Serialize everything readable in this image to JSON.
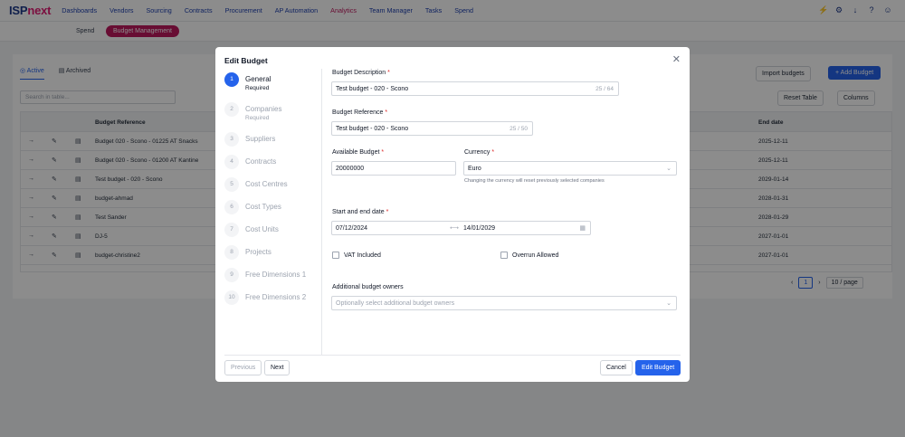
{
  "app": {
    "logo_isp": "ISP",
    "logo_next": "next"
  },
  "nav": [
    "Dashboards",
    "Vendors",
    "Sourcing",
    "Contracts",
    "Procurement",
    "AP Automation",
    "Analytics",
    "Team Manager",
    "Tasks",
    "Spend"
  ],
  "subnav": {
    "spend": "Spend",
    "budget_management": "Budget Management"
  },
  "page": {
    "tab_active": "Active",
    "tab_archived": "Archived",
    "search_placeholder": "Search in table...",
    "import_button": "Import budgets",
    "add_button": "+ Add Budget",
    "reset_button": "Reset Table",
    "columns_button": "Columns",
    "col_reference": "Budget Reference",
    "col_end_date": "End date",
    "rows": [
      {
        "ref": "Budget 020 - Scono - 01225 AT Snacks",
        "end": "2025-12-11"
      },
      {
        "ref": "Budget 020 - Scono - 01200 AT Kantine",
        "end": "2025-12-11"
      },
      {
        "ref": "Test budget - 020 - Scono",
        "end": "2029-01-14"
      },
      {
        "ref": "budget-ahmad",
        "end": "2028-01-31"
      },
      {
        "ref": "Test Sander",
        "end": "2028-01-29"
      },
      {
        "ref": "DJ-5",
        "end": "2027-01-01"
      },
      {
        "ref": "budget-christine2",
        "end": "2027-01-01"
      }
    ],
    "page_number": "1",
    "per_page": "10 / page"
  },
  "modal": {
    "title": "Edit Budget",
    "steps": [
      {
        "num": "1",
        "label": "General",
        "sub": "Required"
      },
      {
        "num": "2",
        "label": "Companies",
        "sub": "Required"
      },
      {
        "num": "3",
        "label": "Suppliers"
      },
      {
        "num": "4",
        "label": "Contracts"
      },
      {
        "num": "5",
        "label": "Cost Centres"
      },
      {
        "num": "6",
        "label": "Cost Types"
      },
      {
        "num": "7",
        "label": "Cost Units"
      },
      {
        "num": "8",
        "label": "Projects"
      },
      {
        "num": "9",
        "label": "Free Dimensions 1"
      },
      {
        "num": "10",
        "label": "Free Dimensions 2"
      }
    ],
    "form": {
      "description_label": "Budget Description",
      "description_value": "Test budget - 020 - Scono",
      "description_count": "25 / 64",
      "reference_label": "Budget Reference",
      "reference_value": "Test budget - 020 - Scono",
      "reference_count": "25 / 50",
      "available_label": "Available Budget",
      "available_value": "20000000",
      "currency_label": "Currency",
      "currency_value": "Euro",
      "currency_hint": "Changing the currency will reset previously selected companies",
      "dates_label": "Start and end date",
      "start_date": "07/12/2024",
      "end_date": "14/01/2029",
      "vat_label": "VAT Included",
      "overrun_label": "Overrun Allowed",
      "owners_label": "Additional budget owners",
      "owners_placeholder": "Optionally select additional budget owners",
      "required_mark": "*"
    },
    "buttons": {
      "previous": "Previous",
      "next": "Next",
      "cancel": "Cancel",
      "submit": "Edit Budget"
    }
  }
}
